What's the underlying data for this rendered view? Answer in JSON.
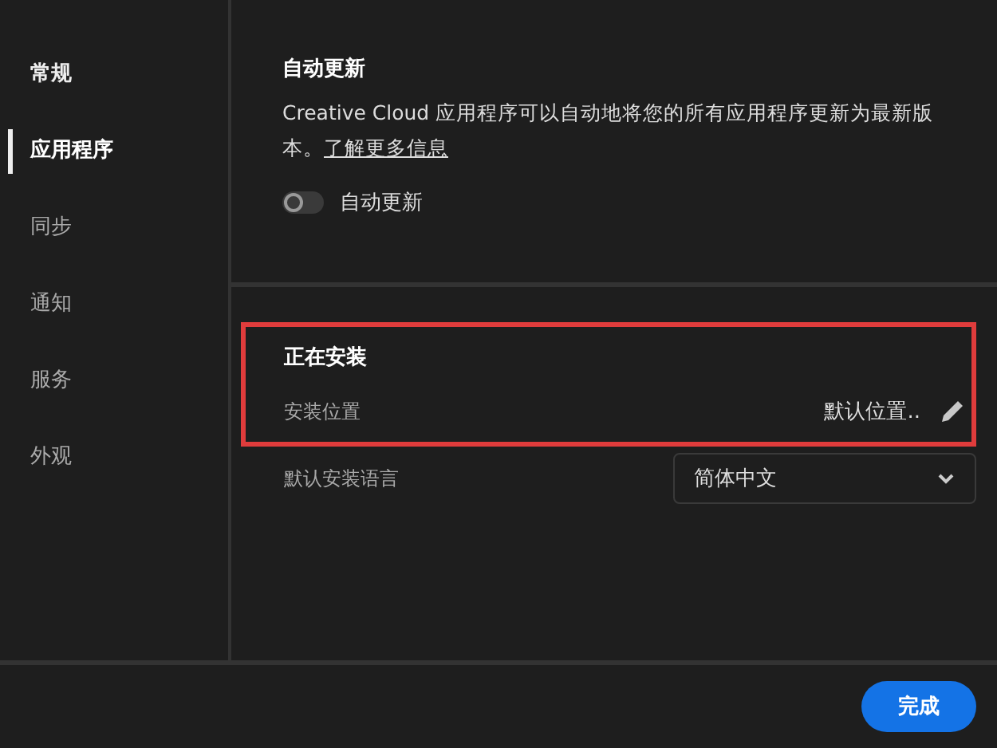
{
  "sidebar": {
    "items": [
      {
        "label": "常规",
        "kind": "header",
        "selected": false
      },
      {
        "label": "应用程序",
        "kind": "item",
        "selected": true
      },
      {
        "label": "同步",
        "kind": "item",
        "selected": false
      },
      {
        "label": "通知",
        "kind": "item",
        "selected": false
      },
      {
        "label": "服务",
        "kind": "item",
        "selected": false
      },
      {
        "label": "外观",
        "kind": "item",
        "selected": false
      }
    ]
  },
  "auto_update": {
    "title": "自动更新",
    "description": "Creative Cloud 应用程序可以自动地将您的所有应用程序更新为最新版本。",
    "link": "了解更多信息",
    "toggle": {
      "label": "自动更新",
      "on": false
    }
  },
  "installing": {
    "title": "正在安装",
    "location_label": "安装位置",
    "location_value": "默认位置..",
    "language_label": "默认安装语言",
    "language_value": "简体中文"
  },
  "buttons": [
    "完成"
  ]
}
